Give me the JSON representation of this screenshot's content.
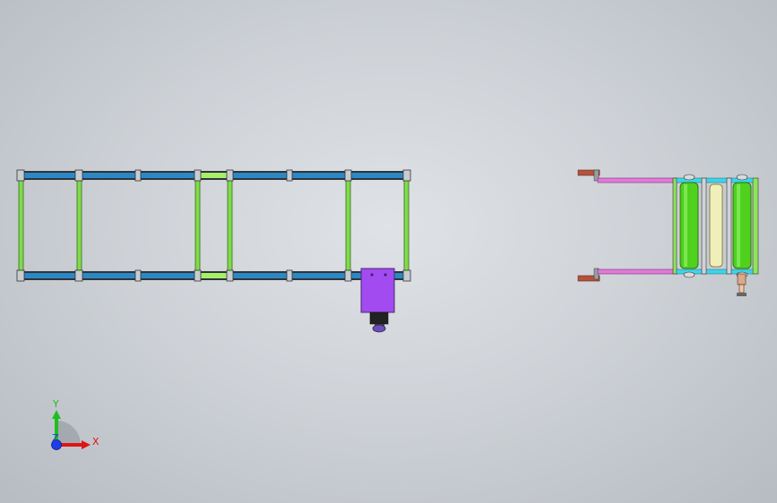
{
  "viewport": {
    "background_top": "#dfe2e6",
    "background_edge": "#b7bcc2"
  },
  "colors": {
    "frame_blue": "#2b88c4",
    "frame_dark": "#3a3f44",
    "post_green": "#7fdc4a",
    "accent_lime": "#a6ef6a",
    "motor_purple": "#a14bf0",
    "motor_dark": "#2a2a2a",
    "rail_magenta": "#e07ad9",
    "bracket_rust": "#b5523a",
    "roller_green": "#4fd11e",
    "roller_cream": "#f1efb9",
    "cyan": "#3fd3e8",
    "axis_x": "#e11414",
    "axis_y": "#1fbe1f",
    "axis_z": "#1e3de6"
  },
  "triad": {
    "x_label": "X",
    "y_label": "Y",
    "z_label": "Z"
  }
}
